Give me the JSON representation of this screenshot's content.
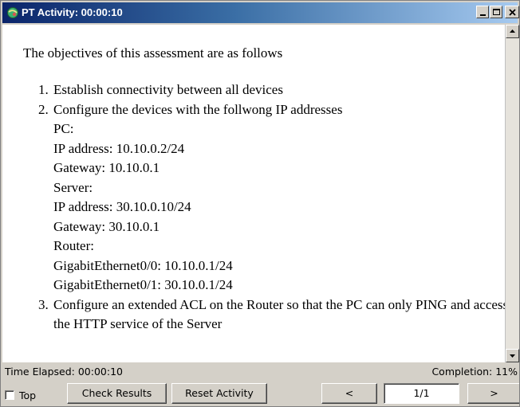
{
  "window": {
    "title": "PT Activity: 00:00:10"
  },
  "icons": {
    "app": "packet-tracer-icon",
    "minimize": "minimize-icon",
    "maximize": "maximize-icon",
    "close": "close-icon",
    "scroll_up": "scroll-up-arrow-icon",
    "scroll_down": "scroll-down-arrow-icon"
  },
  "content": {
    "intro": "The objectives of this assessment are as follows",
    "objectives": [
      {
        "text": "Establish connectivity between all devices",
        "sub": []
      },
      {
        "text": "Configure the devices with the follwong IP addresses",
        "sub": [
          "PC:",
          "IP address: 10.10.0.2/24",
          "Gateway: 10.10.0.1",
          "Server:",
          "IP address: 30.10.0.10/24",
          "Gateway: 30.10.0.1",
          "Router:",
          "GigabitEthernet0/0: 10.10.0.1/24",
          "GigabitEthernet0/1: 30.10.0.1/24"
        ]
      },
      {
        "text": "Configure an extended ACL on the Router so that the PC can only PING and access the HTTP service of the Server",
        "sub": []
      }
    ]
  },
  "status": {
    "time_elapsed": "Time Elapsed: 00:00:10",
    "completion": "Completion: 11%"
  },
  "controls": {
    "top_label": "Top",
    "top_checked": false,
    "check_results": "Check Results",
    "reset_activity": "Reset Activity",
    "prev": "<",
    "page": "1/1",
    "next": ">"
  },
  "colors": {
    "title_bar_start": "#0a246a",
    "title_bar_end": "#a6caf0",
    "window_face": "#d4d0c8"
  }
}
